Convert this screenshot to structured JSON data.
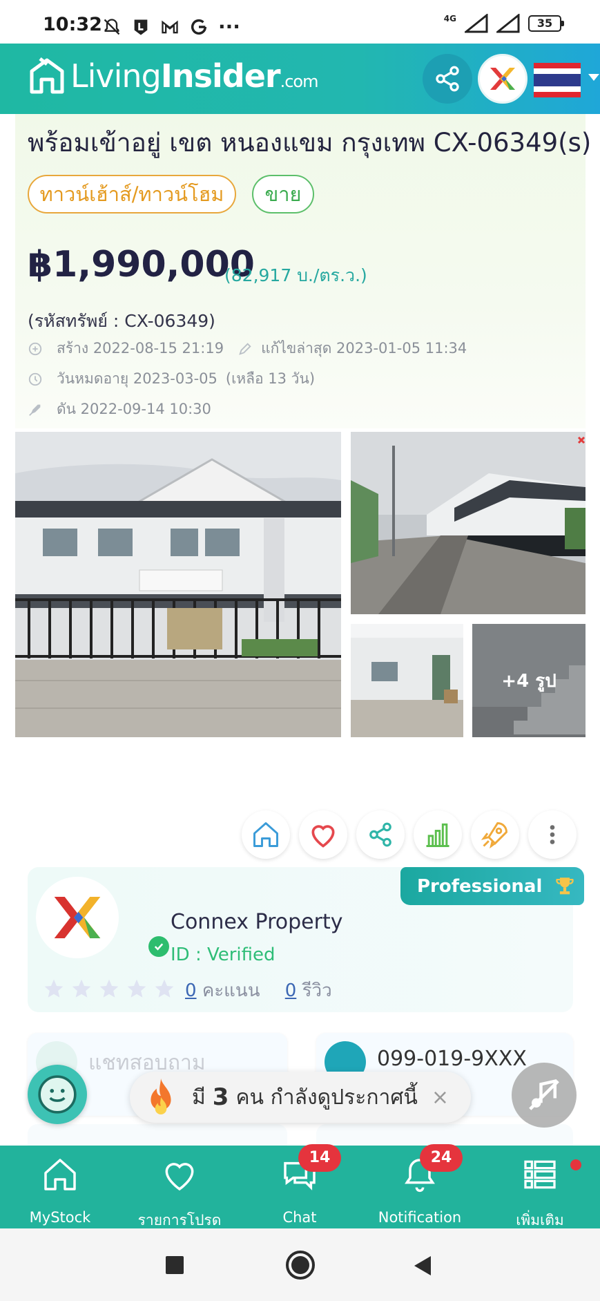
{
  "status_bar": {
    "time": "10:32",
    "network": "4G",
    "battery": "35",
    "icons": [
      "bell-off-icon",
      "app-l-icon",
      "gmail-icon",
      "google-icon",
      "more-dots-icon",
      "signal-icon",
      "signal-icon",
      "battery-icon"
    ],
    "more": "···"
  },
  "header": {
    "logo_light": "Living",
    "logo_bold": "Insider",
    "logo_suffix": ".com",
    "icons": [
      "share-icon",
      "avatar-icon",
      "thai-flag-icon",
      "chevron-down-icon"
    ]
  },
  "listing": {
    "title": "พร้อมเข้าอยู่ เขต หนองแขม กรุงเทพ CX-06349(s)",
    "type_tag": "ทาวน์เฮ้าส์/ทาวน์โฮม",
    "deal_tag": "ขาย",
    "price": "฿1,990,000",
    "price_per_sqw": "(82,917 บ./ตร.ว.)",
    "property_code": "(รหัสทรัพย์ : CX-06349)",
    "created": "สร้าง 2022-08-15 21:19",
    "edited": "แก้ไขล่าสุด 2023-01-05 11:34",
    "expires": "วันหมดอายุ 2023-03-05",
    "days_left": "(เหลือ 13 วัน)",
    "boosted": "ดัน 2022-09-14 10:30",
    "more_photos": "+4 รูป",
    "photo_watermark": "CO"
  },
  "actions": [
    "home-icon",
    "heart-icon",
    "share-icon",
    "chart-icon",
    "rocket-icon",
    "more-vertical-icon"
  ],
  "agent": {
    "badge": "Professional",
    "name": "Connex Property",
    "id_status": "ID : Verified",
    "stars": 5,
    "score_count": "0",
    "score_label": "คะแนน",
    "review_count": "0",
    "review_label": "รีวิว"
  },
  "contact": {
    "chat_label": "แชทสอบถาม",
    "phone": "099-019-9XXX"
  },
  "floating": {
    "watch_prefix": "มี",
    "watch_count": "3",
    "watch_suffix": "คน กำลังดูประกาศนี้",
    "close": "×"
  },
  "bottom_nav": [
    {
      "label": "MyStock",
      "icon": "home-icon",
      "badge": ""
    },
    {
      "label": "รายการโปรด",
      "icon": "heart-icon",
      "badge": ""
    },
    {
      "label": "Chat",
      "icon": "chat-icon",
      "badge": "14"
    },
    {
      "label": "Notification",
      "icon": "bell-icon",
      "badge": "24"
    },
    {
      "label": "เพิ่มเติม",
      "icon": "menu-list-icon",
      "badge": ""
    }
  ],
  "colors": {
    "brand": "#22b39c",
    "price_sub": "#26a8a0",
    "tag_type": "#e49a1f",
    "tag_sale": "#3bab4f",
    "badge_red": "#e5343d"
  }
}
